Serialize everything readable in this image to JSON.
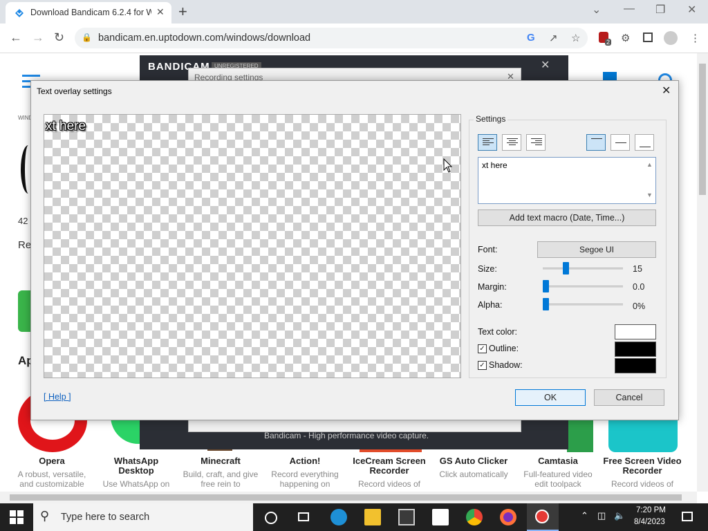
{
  "browser": {
    "tab_title": "Download Bandicam 6.2.4 for W",
    "tab_close": "✕",
    "new_tab": "+",
    "url": "bandicam.en.uptodown.com/windows/download",
    "ext_badge": "2",
    "window_min": "—",
    "window_max": "❐",
    "window_close": "✕",
    "tab_list": "⌄"
  },
  "page": {
    "apps": [
      {
        "name": "Opera",
        "desc": "A robust, versatile, and customizable"
      },
      {
        "name": "WhatsApp Desktop",
        "desc": "Use WhatsApp on"
      },
      {
        "name": "Minecraft",
        "desc": "Build, craft, and give free rein to"
      },
      {
        "name": "Action!",
        "desc": "Record everything happening on"
      },
      {
        "name": "IceCream Screen Recorder",
        "desc": "Record videos of"
      },
      {
        "name": "GS Auto Clicker",
        "desc": "Click automatically"
      },
      {
        "name": "Camtasia",
        "desc": "Full-featured video edit toolpack"
      },
      {
        "name": "Free Screen Video Recorder",
        "desc": "Record videos of"
      }
    ],
    "partial_left": [
      "42",
      "Re",
      "Ap",
      "WIND"
    ]
  },
  "bandicam": {
    "logo": "BANDICAM",
    "unregistered": "UNREGISTERED",
    "recording_settings_title": "Recording settings",
    "footer": "Bandicam - High performance video capture."
  },
  "dialog": {
    "title": "Text overlay settings",
    "close": "✕",
    "preview_text": "xt here",
    "settings_label": "Settings",
    "text_value": "xt here",
    "macro_button": "Add text macro (Date, Time...)",
    "font_label": "Font:",
    "font_value": "Segoe UI",
    "size_label": "Size:",
    "size_value": "15",
    "size_level": 0.27,
    "margin_label": "Margin:",
    "margin_value": "0.0",
    "margin_level": 0.0,
    "alpha_label": "Alpha:",
    "alpha_value": "0%",
    "alpha_level": 0.0,
    "text_color_label": "Text color:",
    "text_color": "#ffffff",
    "outline_label": "Outline:",
    "outline_checked": true,
    "outline_color": "#000000",
    "shadow_label": "Shadow:",
    "shadow_checked": true,
    "shadow_color": "#000000",
    "check_mark": "✓",
    "help_link": "[ Help ]",
    "ok_button": "OK",
    "cancel_button": "Cancel"
  },
  "taskbar": {
    "search_placeholder": "Type here to search",
    "time": "7:20 PM",
    "date": "8/4/2023"
  }
}
